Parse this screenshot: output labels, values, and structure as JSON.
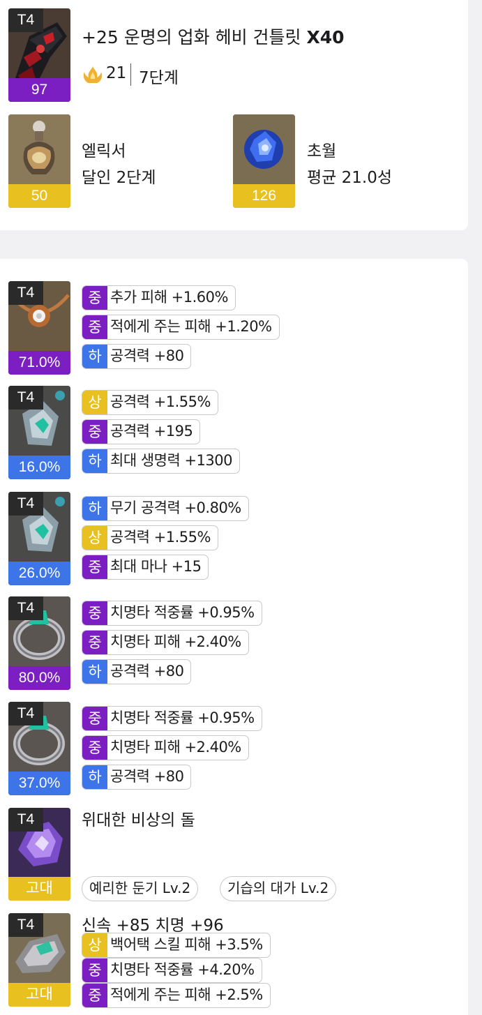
{
  "equipment": {
    "weapon": {
      "tier": "T4",
      "quality": "97",
      "name_prefix": "+25 운명의 업화 헤비 건틀릿 ",
      "name_bold": "X40",
      "advance_level": "21",
      "stage": "7단계",
      "icon": "gauntlet-icon"
    },
    "elixir": {
      "label": "엘릭서",
      "value": "달인 2단계",
      "count": "50",
      "icon": "elixir-flask-icon"
    },
    "transcend": {
      "label": "초월",
      "value": "평균 21.0성",
      "count": "126",
      "icon": "transcend-orb-icon"
    }
  },
  "accessories": [
    {
      "tier": "T4",
      "quality": "71.0%",
      "quality_color": "#7b1fc2",
      "icon": "necklace-icon",
      "options": [
        {
          "grade": "중",
          "text": "추가 피해 +1.60%"
        },
        {
          "grade": "중",
          "text": "적에게 주는 피해 +1.20%"
        },
        {
          "grade": "하",
          "text": "공격력 +80"
        }
      ]
    },
    {
      "tier": "T4",
      "quality": "16.0%",
      "quality_color": "#3d74e8",
      "icon": "earring-icon",
      "options": [
        {
          "grade": "상",
          "text": "공격력 +1.55%"
        },
        {
          "grade": "중",
          "text": "공격력 +195"
        },
        {
          "grade": "하",
          "text": "최대 생명력 +1300"
        }
      ]
    },
    {
      "tier": "T4",
      "quality": "26.0%",
      "quality_color": "#3d74e8",
      "icon": "earring-icon",
      "options": [
        {
          "grade": "하",
          "text": "무기 공격력 +0.80%"
        },
        {
          "grade": "상",
          "text": "공격력 +1.55%"
        },
        {
          "grade": "중",
          "text": "최대 마나 +15"
        }
      ]
    },
    {
      "tier": "T4",
      "quality": "80.0%",
      "quality_color": "#7b1fc2",
      "icon": "ring-icon",
      "options": [
        {
          "grade": "중",
          "text": "치명타 적중률 +0.95%"
        },
        {
          "grade": "중",
          "text": "치명타 피해 +2.40%"
        },
        {
          "grade": "하",
          "text": "공격력 +80"
        }
      ]
    },
    {
      "tier": "T4",
      "quality": "37.0%",
      "quality_color": "#3d74e8",
      "icon": "ring-icon",
      "options": [
        {
          "grade": "중",
          "text": "치명타 적중률 +0.95%"
        },
        {
          "grade": "중",
          "text": "치명타 피해 +2.40%"
        },
        {
          "grade": "하",
          "text": "공격력 +80"
        }
      ]
    }
  ],
  "stone": {
    "tier": "T4",
    "grade": "고대",
    "name": "위대한 비상의 돌",
    "icon": "ability-stone-icon",
    "engravings": [
      "예리한 둔기 Lv.2",
      "기습의 대가 Lv.2"
    ]
  },
  "bracelet": {
    "tier": "T4",
    "grade": "고대",
    "stats": "신속 +85 치명 +96",
    "icon": "bracelet-icon",
    "options": [
      {
        "grade": "상",
        "text": "백어택 스킬 피해 +3.5%"
      },
      {
        "grade": "중",
        "text": "치명타 적중률 +4.20%"
      },
      {
        "grade": "중",
        "text": "적에게 주는 피해 +2.5%"
      }
    ]
  },
  "colors": {
    "grade_high": "#e8c020",
    "grade_mid": "#7b1fc2",
    "grade_low": "#3d74e8",
    "ancient": "#e8c020"
  }
}
